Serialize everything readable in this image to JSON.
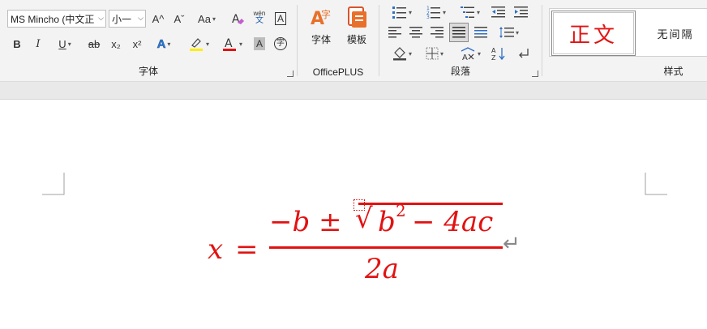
{
  "font_group": {
    "label": "字体",
    "font_name": "MS Mincho (中文正",
    "font_size": "小一",
    "grow_font_label": "A^",
    "shrink_font_label": "Aˇ",
    "change_case_label": "Aa",
    "bold_label": "B",
    "italic_label": "I",
    "underline_label": "U",
    "strike_label": "ab",
    "subscript_label": "x₂",
    "superscript_label": "x²",
    "phonetic_top": "wén",
    "phonetic_bottom": "文",
    "border_char_label": "A",
    "shading_label": "A",
    "enclose_label": "字",
    "highlight_color": "#ffee00",
    "font_color": "#e21212"
  },
  "officeplus_group": {
    "label": "OfficePLUS",
    "font_button_label": "字体",
    "template_button_label": "模板"
  },
  "paragraph_group": {
    "label": "段落"
  },
  "styles_group": {
    "label": "样式",
    "styles": [
      "正文",
      "无间隔"
    ]
  },
  "formula": {
    "lhs": "x",
    "equals": "=",
    "numerator_left": "−b ±",
    "radicand": "b",
    "exponent": "2",
    "radicand_rest": "− 4ac",
    "denominator": "2a",
    "radical_symbol": "√",
    "paragraph_mark": "↵",
    "color": "#e21212"
  }
}
